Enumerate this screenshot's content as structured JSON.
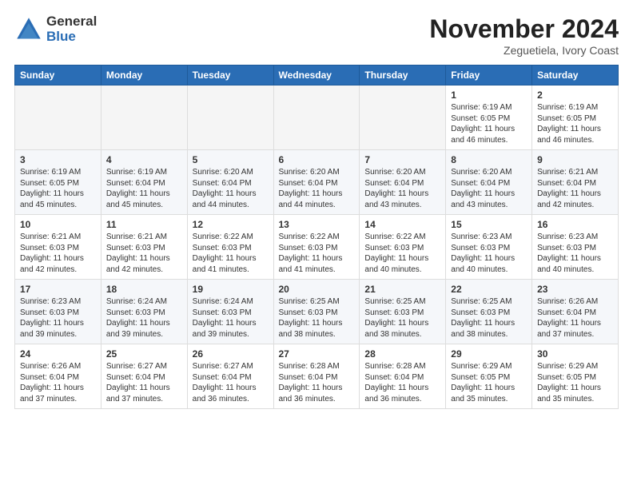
{
  "header": {
    "logo_general": "General",
    "logo_blue": "Blue",
    "month": "November 2024",
    "location": "Zeguetiela, Ivory Coast"
  },
  "weekdays": [
    "Sunday",
    "Monday",
    "Tuesday",
    "Wednesday",
    "Thursday",
    "Friday",
    "Saturday"
  ],
  "weeks": [
    [
      {
        "day": "",
        "info": ""
      },
      {
        "day": "",
        "info": ""
      },
      {
        "day": "",
        "info": ""
      },
      {
        "day": "",
        "info": ""
      },
      {
        "day": "",
        "info": ""
      },
      {
        "day": "1",
        "info": "Sunrise: 6:19 AM\nSunset: 6:05 PM\nDaylight: 11 hours\nand 46 minutes."
      },
      {
        "day": "2",
        "info": "Sunrise: 6:19 AM\nSunset: 6:05 PM\nDaylight: 11 hours\nand 46 minutes."
      }
    ],
    [
      {
        "day": "3",
        "info": "Sunrise: 6:19 AM\nSunset: 6:05 PM\nDaylight: 11 hours\nand 45 minutes."
      },
      {
        "day": "4",
        "info": "Sunrise: 6:19 AM\nSunset: 6:04 PM\nDaylight: 11 hours\nand 45 minutes."
      },
      {
        "day": "5",
        "info": "Sunrise: 6:20 AM\nSunset: 6:04 PM\nDaylight: 11 hours\nand 44 minutes."
      },
      {
        "day": "6",
        "info": "Sunrise: 6:20 AM\nSunset: 6:04 PM\nDaylight: 11 hours\nand 44 minutes."
      },
      {
        "day": "7",
        "info": "Sunrise: 6:20 AM\nSunset: 6:04 PM\nDaylight: 11 hours\nand 43 minutes."
      },
      {
        "day": "8",
        "info": "Sunrise: 6:20 AM\nSunset: 6:04 PM\nDaylight: 11 hours\nand 43 minutes."
      },
      {
        "day": "9",
        "info": "Sunrise: 6:21 AM\nSunset: 6:04 PM\nDaylight: 11 hours\nand 42 minutes."
      }
    ],
    [
      {
        "day": "10",
        "info": "Sunrise: 6:21 AM\nSunset: 6:03 PM\nDaylight: 11 hours\nand 42 minutes."
      },
      {
        "day": "11",
        "info": "Sunrise: 6:21 AM\nSunset: 6:03 PM\nDaylight: 11 hours\nand 42 minutes."
      },
      {
        "day": "12",
        "info": "Sunrise: 6:22 AM\nSunset: 6:03 PM\nDaylight: 11 hours\nand 41 minutes."
      },
      {
        "day": "13",
        "info": "Sunrise: 6:22 AM\nSunset: 6:03 PM\nDaylight: 11 hours\nand 41 minutes."
      },
      {
        "day": "14",
        "info": "Sunrise: 6:22 AM\nSunset: 6:03 PM\nDaylight: 11 hours\nand 40 minutes."
      },
      {
        "day": "15",
        "info": "Sunrise: 6:23 AM\nSunset: 6:03 PM\nDaylight: 11 hours\nand 40 minutes."
      },
      {
        "day": "16",
        "info": "Sunrise: 6:23 AM\nSunset: 6:03 PM\nDaylight: 11 hours\nand 40 minutes."
      }
    ],
    [
      {
        "day": "17",
        "info": "Sunrise: 6:23 AM\nSunset: 6:03 PM\nDaylight: 11 hours\nand 39 minutes."
      },
      {
        "day": "18",
        "info": "Sunrise: 6:24 AM\nSunset: 6:03 PM\nDaylight: 11 hours\nand 39 minutes."
      },
      {
        "day": "19",
        "info": "Sunrise: 6:24 AM\nSunset: 6:03 PM\nDaylight: 11 hours\nand 39 minutes."
      },
      {
        "day": "20",
        "info": "Sunrise: 6:25 AM\nSunset: 6:03 PM\nDaylight: 11 hours\nand 38 minutes."
      },
      {
        "day": "21",
        "info": "Sunrise: 6:25 AM\nSunset: 6:03 PM\nDaylight: 11 hours\nand 38 minutes."
      },
      {
        "day": "22",
        "info": "Sunrise: 6:25 AM\nSunset: 6:03 PM\nDaylight: 11 hours\nand 38 minutes."
      },
      {
        "day": "23",
        "info": "Sunrise: 6:26 AM\nSunset: 6:04 PM\nDaylight: 11 hours\nand 37 minutes."
      }
    ],
    [
      {
        "day": "24",
        "info": "Sunrise: 6:26 AM\nSunset: 6:04 PM\nDaylight: 11 hours\nand 37 minutes."
      },
      {
        "day": "25",
        "info": "Sunrise: 6:27 AM\nSunset: 6:04 PM\nDaylight: 11 hours\nand 37 minutes."
      },
      {
        "day": "26",
        "info": "Sunrise: 6:27 AM\nSunset: 6:04 PM\nDaylight: 11 hours\nand 36 minutes."
      },
      {
        "day": "27",
        "info": "Sunrise: 6:28 AM\nSunset: 6:04 PM\nDaylight: 11 hours\nand 36 minutes."
      },
      {
        "day": "28",
        "info": "Sunrise: 6:28 AM\nSunset: 6:04 PM\nDaylight: 11 hours\nand 36 minutes."
      },
      {
        "day": "29",
        "info": "Sunrise: 6:29 AM\nSunset: 6:05 PM\nDaylight: 11 hours\nand 35 minutes."
      },
      {
        "day": "30",
        "info": "Sunrise: 6:29 AM\nSunset: 6:05 PM\nDaylight: 11 hours\nand 35 minutes."
      }
    ]
  ]
}
